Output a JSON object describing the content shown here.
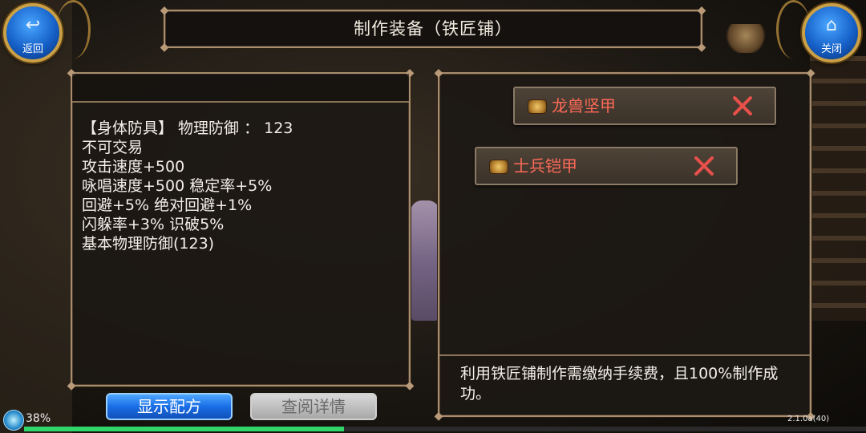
{
  "window": {
    "title": "制作装备（铁匠铺）"
  },
  "nav": {
    "back": {
      "label": "返回",
      "icon": "return-arrow-icon"
    },
    "close": {
      "label": "关闭",
      "icon": "home-icon"
    }
  },
  "item_info": {
    "lines": [
      "【身体防具】 物理防御 ： 123",
      "不可交易",
      "攻击速度+500",
      "咏唱速度+500 稳定率+5%",
      "回避+5% 绝对回避+1%",
      "闪躲率+3% 识破5%",
      "基本物理防御(123)"
    ]
  },
  "recipes": [
    {
      "name": "龙兽坚甲",
      "icon": "scroll-icon",
      "color": "#ff6a58"
    },
    {
      "name": "士兵铠甲",
      "icon": "scroll-icon",
      "color": "#ff6a58"
    }
  ],
  "note": "利用铁匠铺制作需缴纳手续费，且100%制作成功。",
  "buttons": {
    "show_recipe": "显示配方",
    "view_details": "查阅详情"
  },
  "status": {
    "percent_label": "38%",
    "progress": 0.38,
    "version": "2.1.0a(40)"
  }
}
